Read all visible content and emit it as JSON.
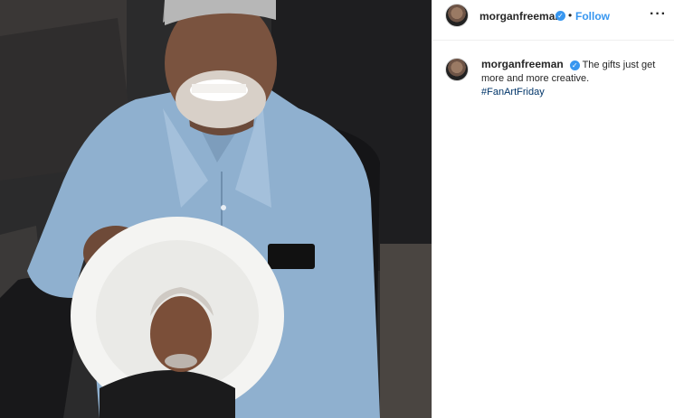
{
  "post": {
    "username": "morganfreeman",
    "verified": true,
    "follow_label": "Follow",
    "separator": "•",
    "more_icon": "more-options-icon",
    "caption_text": "The gifts just get more and more creative.",
    "hashtag": "#FanArtFriday"
  },
  "colors": {
    "link_blue": "#3897f0",
    "hashtag_blue": "#003569",
    "text": "#262626",
    "border": "#efefef"
  }
}
